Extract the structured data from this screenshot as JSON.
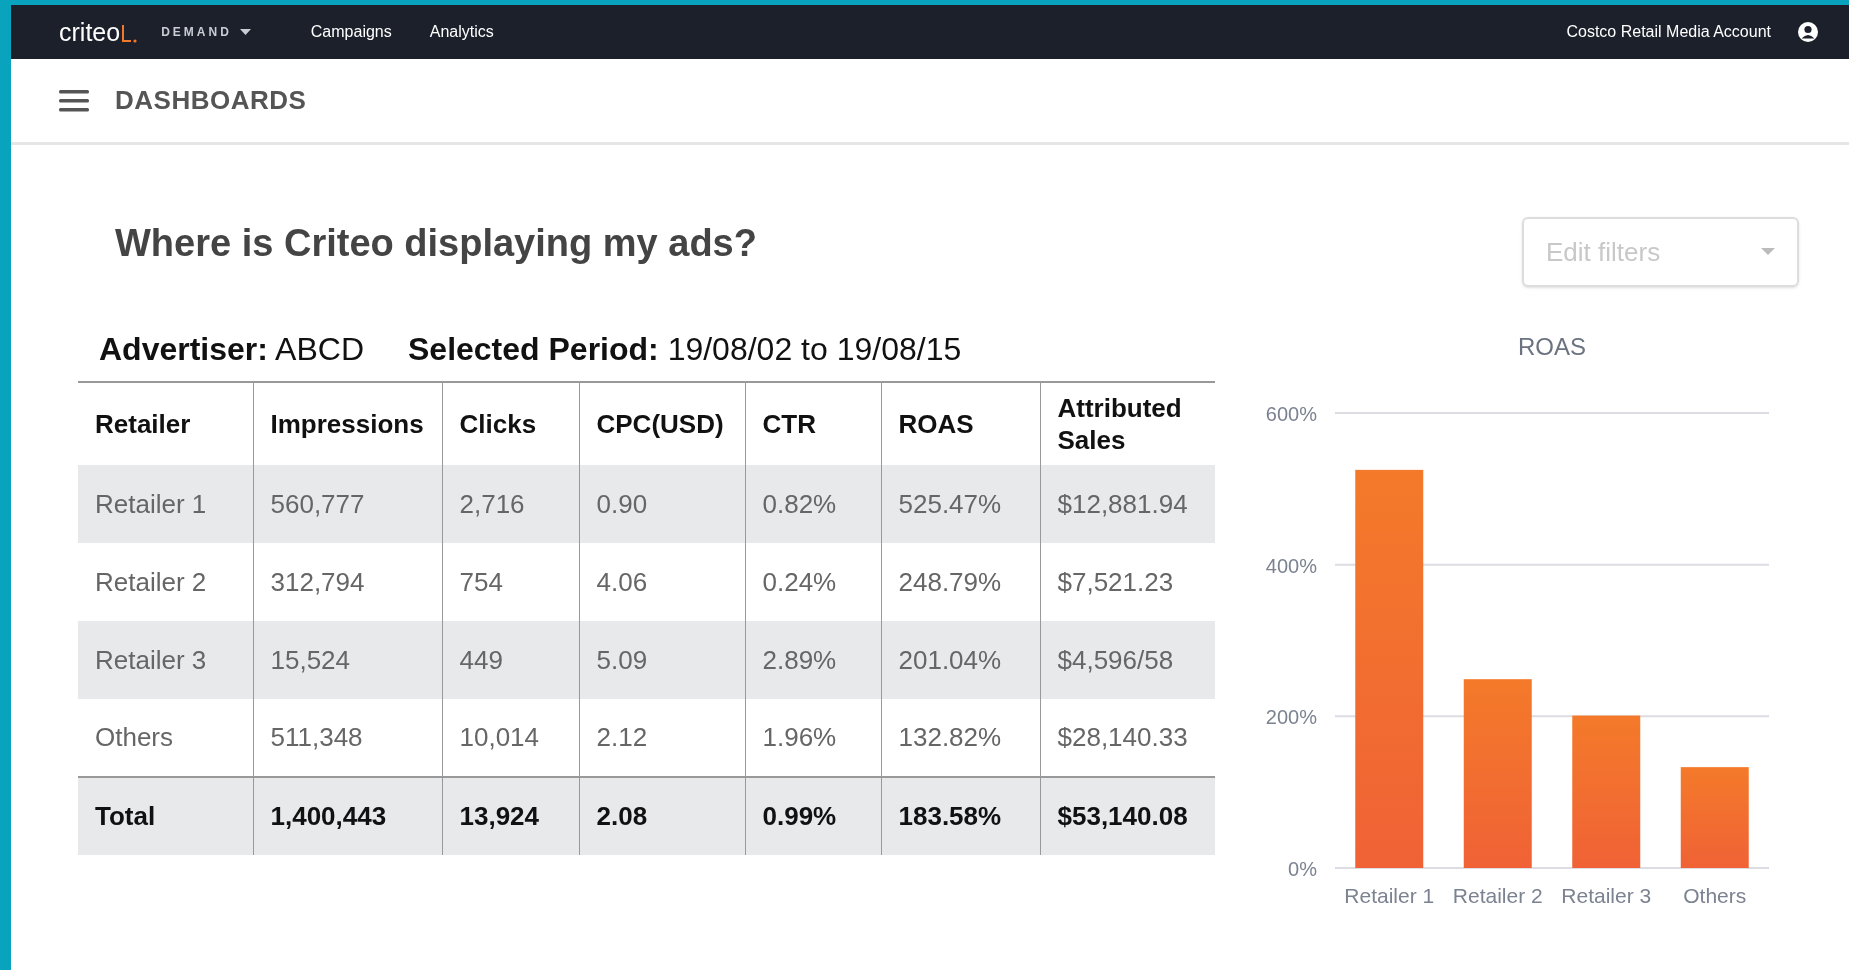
{
  "navbar": {
    "logo": "criteo",
    "product_menu": "DEMAND",
    "links": [
      "Campaigns",
      "Analytics"
    ],
    "account": "Costco Retail Media Account"
  },
  "subheader": {
    "title": "DASHBOARDS"
  },
  "heading": "Where is Criteo displaying my ads?",
  "filters": {
    "placeholder": "Edit filters"
  },
  "summary": {
    "advertiser_label": "Advertiser:",
    "advertiser": "ABCD",
    "period_label": "Selected Period:",
    "period": "19/08/02 to 19/08/15"
  },
  "table": {
    "columns": [
      "Retailer",
      "Impressions",
      "Clicks",
      "CPC(USD)",
      "CTR",
      "ROAS",
      "Attributed Sales"
    ],
    "rows": [
      [
        "Retailer 1",
        "560,777",
        "2,716",
        "0.90",
        "0.82%",
        "525.47%",
        "$12,881.94"
      ],
      [
        "Retailer 2",
        "312,794",
        "754",
        "4.06",
        "0.24%",
        "248.79%",
        "$7,521.23"
      ],
      [
        "Retailer 3",
        "15,524",
        "449",
        "5.09",
        "2.89%",
        "201.04%",
        "$4,596/58"
      ],
      [
        "Others",
        "511,348",
        "10,014",
        "2.12",
        "1.96%",
        "132.82%",
        "$28,140.33"
      ]
    ],
    "total": [
      "Total",
      "1,400,443",
      "13,924",
      "2.08",
      "0.99%",
      "183.58%",
      "$53,140.08"
    ]
  },
  "chart_data": {
    "type": "bar",
    "title": "ROAS",
    "categories": [
      "Retailer 1",
      "Retailer 2",
      "Retailer 3",
      "Others"
    ],
    "series": [
      {
        "color": "#f47a2a",
        "values": [
          525,
          249,
          201,
          133
        ]
      }
    ],
    "ylim": [
      0,
      600
    ],
    "yticks": [
      {
        "value": 0,
        "label": "0%"
      },
      {
        "value": 200,
        "label": "200%"
      },
      {
        "value": 400,
        "label": "400%"
      },
      {
        "value": 600,
        "label": "600%"
      }
    ]
  }
}
